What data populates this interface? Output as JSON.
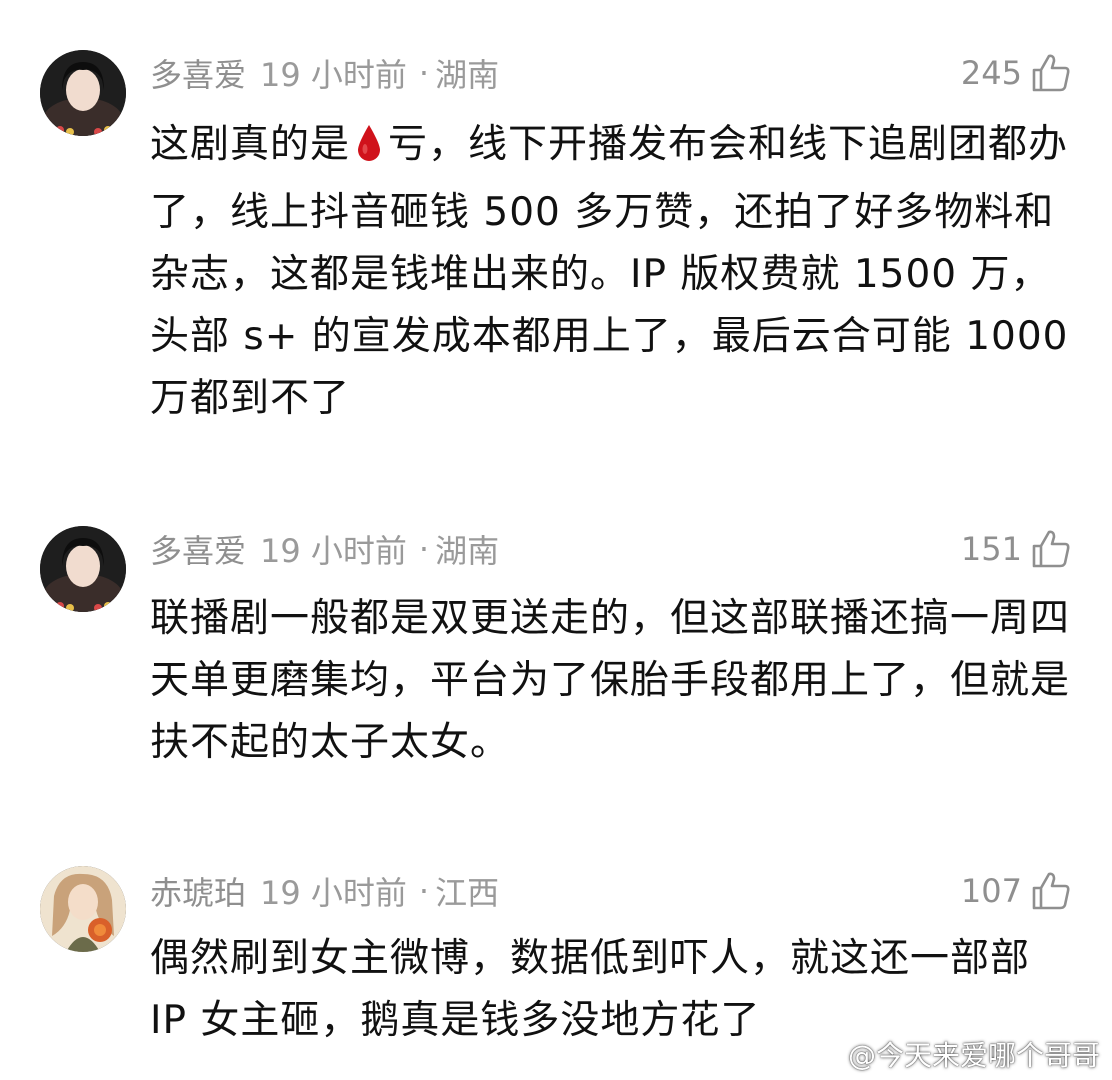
{
  "comments": [
    {
      "username": "多喜爱",
      "time": "19 小时前",
      "separator": "·",
      "location": "湖南",
      "likes": "245",
      "text_before_icon": "这剧真的是",
      "icon": "blood-drop-icon",
      "text_after_icon": "亏，线下开播发布会和线下追剧团都办了，线上抖音砸钱 500 多万赞，还拍了好多物料和杂志，这都是钱堆出来的。IP 版权费就 1500 万，头部 s+ 的宣发成本都用上了，最后云合可能 1000 万都到不了"
    },
    {
      "username": "多喜爱",
      "time": "19 小时前",
      "separator": "·",
      "location": "湖南",
      "likes": "151",
      "text": "联播剧一般都是双更送走的，但这部联播还搞一周四天单更磨集均，平台为了保胎手段都用上了，但就是扶不起的太子太女。"
    },
    {
      "username": "赤琥珀",
      "time": "19 小时前",
      "separator": "·",
      "location": "江西",
      "likes": "107",
      "text": "偶然刷到女主微博，数据低到吓人，就这还一部部 IP 女主砸，鹅真是钱多没地方花了"
    }
  ],
  "watermark": {
    "icon": "weibo-icon",
    "text": "@今天来爱哪个哥哥"
  },
  "colors": {
    "meta": "#9a9a9a",
    "text": "#111111",
    "drop": "#d0121b"
  }
}
